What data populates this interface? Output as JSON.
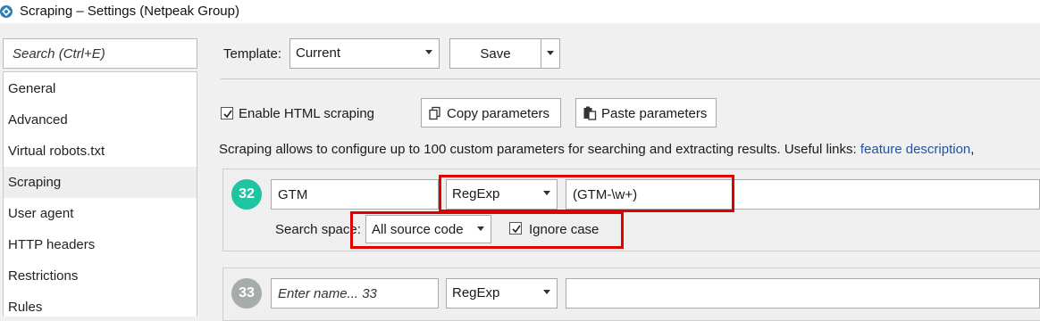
{
  "window": {
    "title": "Scraping – Settings (Netpeak Group)",
    "icon": "netpeak-app-icon"
  },
  "sidebar": {
    "search_placeholder": "Search (Ctrl+E)",
    "items": [
      {
        "label": "General"
      },
      {
        "label": "Advanced"
      },
      {
        "label": "Virtual robots.txt"
      },
      {
        "label": "Scraping",
        "active": true
      },
      {
        "label": "User agent"
      },
      {
        "label": "HTTP headers"
      },
      {
        "label": "Restrictions"
      },
      {
        "label": "Rules"
      }
    ]
  },
  "toolbar": {
    "template_label": "Template:",
    "template_value": "Current",
    "save_label": "Save"
  },
  "scraping": {
    "enable_label": "Enable HTML scraping",
    "enable_checked": true,
    "copy_label": "Copy parameters",
    "paste_label": "Paste parameters",
    "description": "Scraping allows to configure up to 100 custom parameters for searching and extracting results. Useful links:",
    "link_text": "feature description",
    "link_suffix": ","
  },
  "params": [
    {
      "number": "32",
      "badge_color": "#1fc4a0",
      "name_value": "GTM",
      "name_placeholder": "",
      "type": "RegExp",
      "expression": "(GTM-\\w+)",
      "search_space_label": "Search space:",
      "search_space": "All source code",
      "ignore_case_label": "Ignore case",
      "ignore_case": true
    },
    {
      "number": "33",
      "badge_color": "#a6aca8",
      "name_value": "",
      "name_placeholder": "Enter name... 33",
      "type": "RegExp",
      "expression": ""
    }
  ],
  "colors": {
    "highlight": "#e10000",
    "link": "#1a55a8"
  }
}
